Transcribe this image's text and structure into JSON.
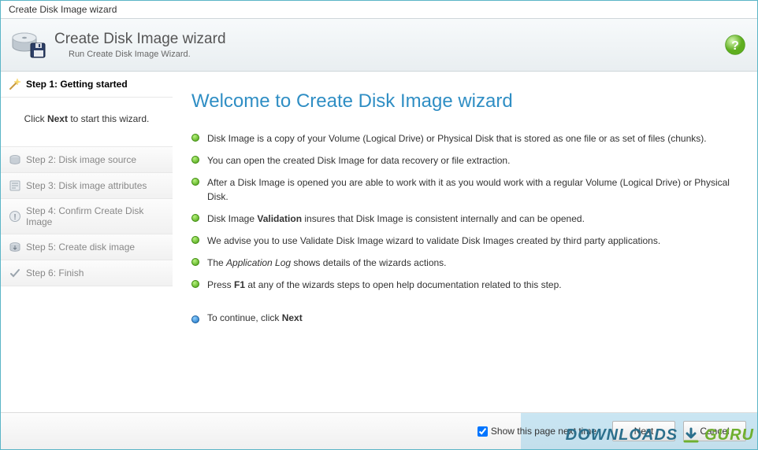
{
  "window": {
    "title": "Create Disk Image wizard"
  },
  "header": {
    "title": "Create Disk Image wizard",
    "subtitle": "Run Create Disk Image Wizard."
  },
  "sidebar": {
    "active_step_label": "Step 1: Getting started",
    "instruction_pre": "Click ",
    "instruction_bold": "Next",
    "instruction_post": " to start this wizard.",
    "steps": [
      {
        "label": "Step 2: Disk image source"
      },
      {
        "label": "Step 3: Disk image attributes"
      },
      {
        "label": "Step 4: Confirm Create Disk Image"
      },
      {
        "label": "Step 5: Create disk image"
      },
      {
        "label": "Step 6: Finish"
      }
    ]
  },
  "content": {
    "welcome_title": "Welcome to Create Disk Image wizard",
    "bullets": [
      {
        "text": "Disk Image is a copy of your Volume (Logical Drive) or Physical Disk that is stored as one file or as set of files (chunks)."
      },
      {
        "text": "You can open the created Disk Image for data recovery or file extraction."
      },
      {
        "text": "After a Disk Image is opened you are able to work with it as you would work with a regular Volume (Logical Drive) or Physical Disk."
      },
      {
        "html": "Disk Image <b>Validation</b> insures that Disk Image is consistent internally and can be opened."
      },
      {
        "text": "We advise you to use Validate Disk Image wizard to validate Disk Images created by third party applications."
      },
      {
        "html": "The <i>Application Log</i> shows details of the wizards actions."
      },
      {
        "html": "Press <b>F1</b> at any of the wizards steps to open help documentation related to this step."
      }
    ],
    "continue_html": "To continue, click <b>Next</b>"
  },
  "footer": {
    "show_next_label": "Show this page next time",
    "show_next_checked": true,
    "next_label": "Next",
    "cancel_label": "Cancel"
  },
  "watermark": {
    "t1": "DOWNLOADS",
    "t2": "GURU"
  }
}
